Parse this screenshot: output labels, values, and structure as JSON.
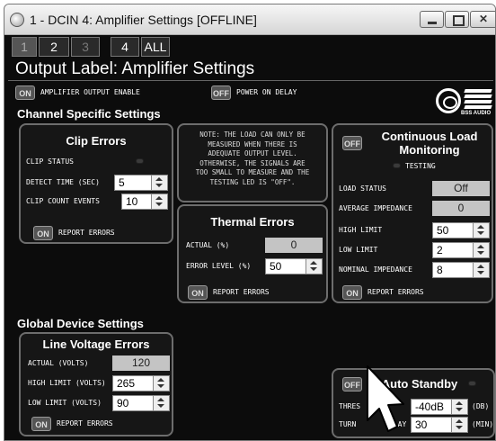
{
  "window": {
    "title": "1 - DCIN 4: Amplifier Settings [OFFLINE]"
  },
  "tabs": [
    {
      "label": "1"
    },
    {
      "label": "2"
    },
    {
      "label": "3"
    },
    {
      "label": "4"
    },
    {
      "label": "ALL"
    }
  ],
  "output_label": "Output Label: Amplifier Settings",
  "toggles": {
    "amp_enable_state": "ON",
    "amp_enable_label": "AMPLIFIER OUTPUT ENABLE",
    "power_delay_state": "OFF",
    "power_delay_label": "POWER ON DELAY"
  },
  "logo": {
    "text": "BSS AUDIO"
  },
  "channel_section": "Channel Specific Settings",
  "clip_errors": {
    "title": "Clip Errors",
    "clip_status_label": "CLIP STATUS",
    "detect_time_label": "DETECT TIME (SEC)",
    "detect_time_value": "5",
    "clip_count_label": "CLIP COUNT EVENTS",
    "clip_count_value": "10",
    "report_state": "ON",
    "report_label": "REPORT ERRORS"
  },
  "note": {
    "lines": [
      "NOTE: THE LOAD CAN ONLY BE",
      "MEASURED WHEN THERE IS",
      "ADEQUATE OUTPUT LEVEL.",
      "OTHERWISE, THE SIGNALS ARE",
      "TOO SMALL TO MEASURE AND THE",
      "TESTING LED IS \"OFF\"."
    ]
  },
  "thermal_errors": {
    "title": "Thermal Errors",
    "actual_label": "ACTUAL (%)",
    "actual_value": "0",
    "error_level_label": "ERROR LEVEL (%)",
    "error_level_value": "50",
    "report_state": "ON",
    "report_label": "REPORT ERRORS"
  },
  "continuous_load": {
    "state": "OFF",
    "title_line1": "Continuous Load",
    "title_line2": "Monitoring",
    "testing_label": "TESTING",
    "load_status_label": "LOAD STATUS",
    "load_status_value": "Off",
    "avg_impedance_label": "AVERAGE IMPEDANCE",
    "avg_impedance_value": "0",
    "high_limit_label": "HIGH LIMIT",
    "high_limit_value": "50",
    "low_limit_label": "LOW LIMIT",
    "low_limit_value": "2",
    "nominal_impedance_label": "NOMINAL IMPEDANCE",
    "nominal_impedance_value": "8",
    "report_state": "ON",
    "report_label": "REPORT ERRORS"
  },
  "global_section": "Global Device Settings",
  "line_voltage": {
    "title": "Line Voltage Errors",
    "actual_label": "ACTUAL (VOLTS)",
    "actual_value": "120",
    "high_limit_label": "HIGH LIMIT (VOLTS)",
    "high_limit_value": "265",
    "low_limit_label": "LOW LIMIT (VOLTS)",
    "low_limit_value": "90",
    "report_state": "ON",
    "report_label": "REPORT ERRORS"
  },
  "auto_standby": {
    "state": "OFF",
    "title": "Auto Standby",
    "threshold_label": "THRES",
    "threshold_value": "-40dB",
    "threshold_unit": "(dB)",
    "delay_label": "TURN",
    "delay_label_tail": "ELAY",
    "delay_value": "30",
    "delay_unit": "(MIN)"
  }
}
